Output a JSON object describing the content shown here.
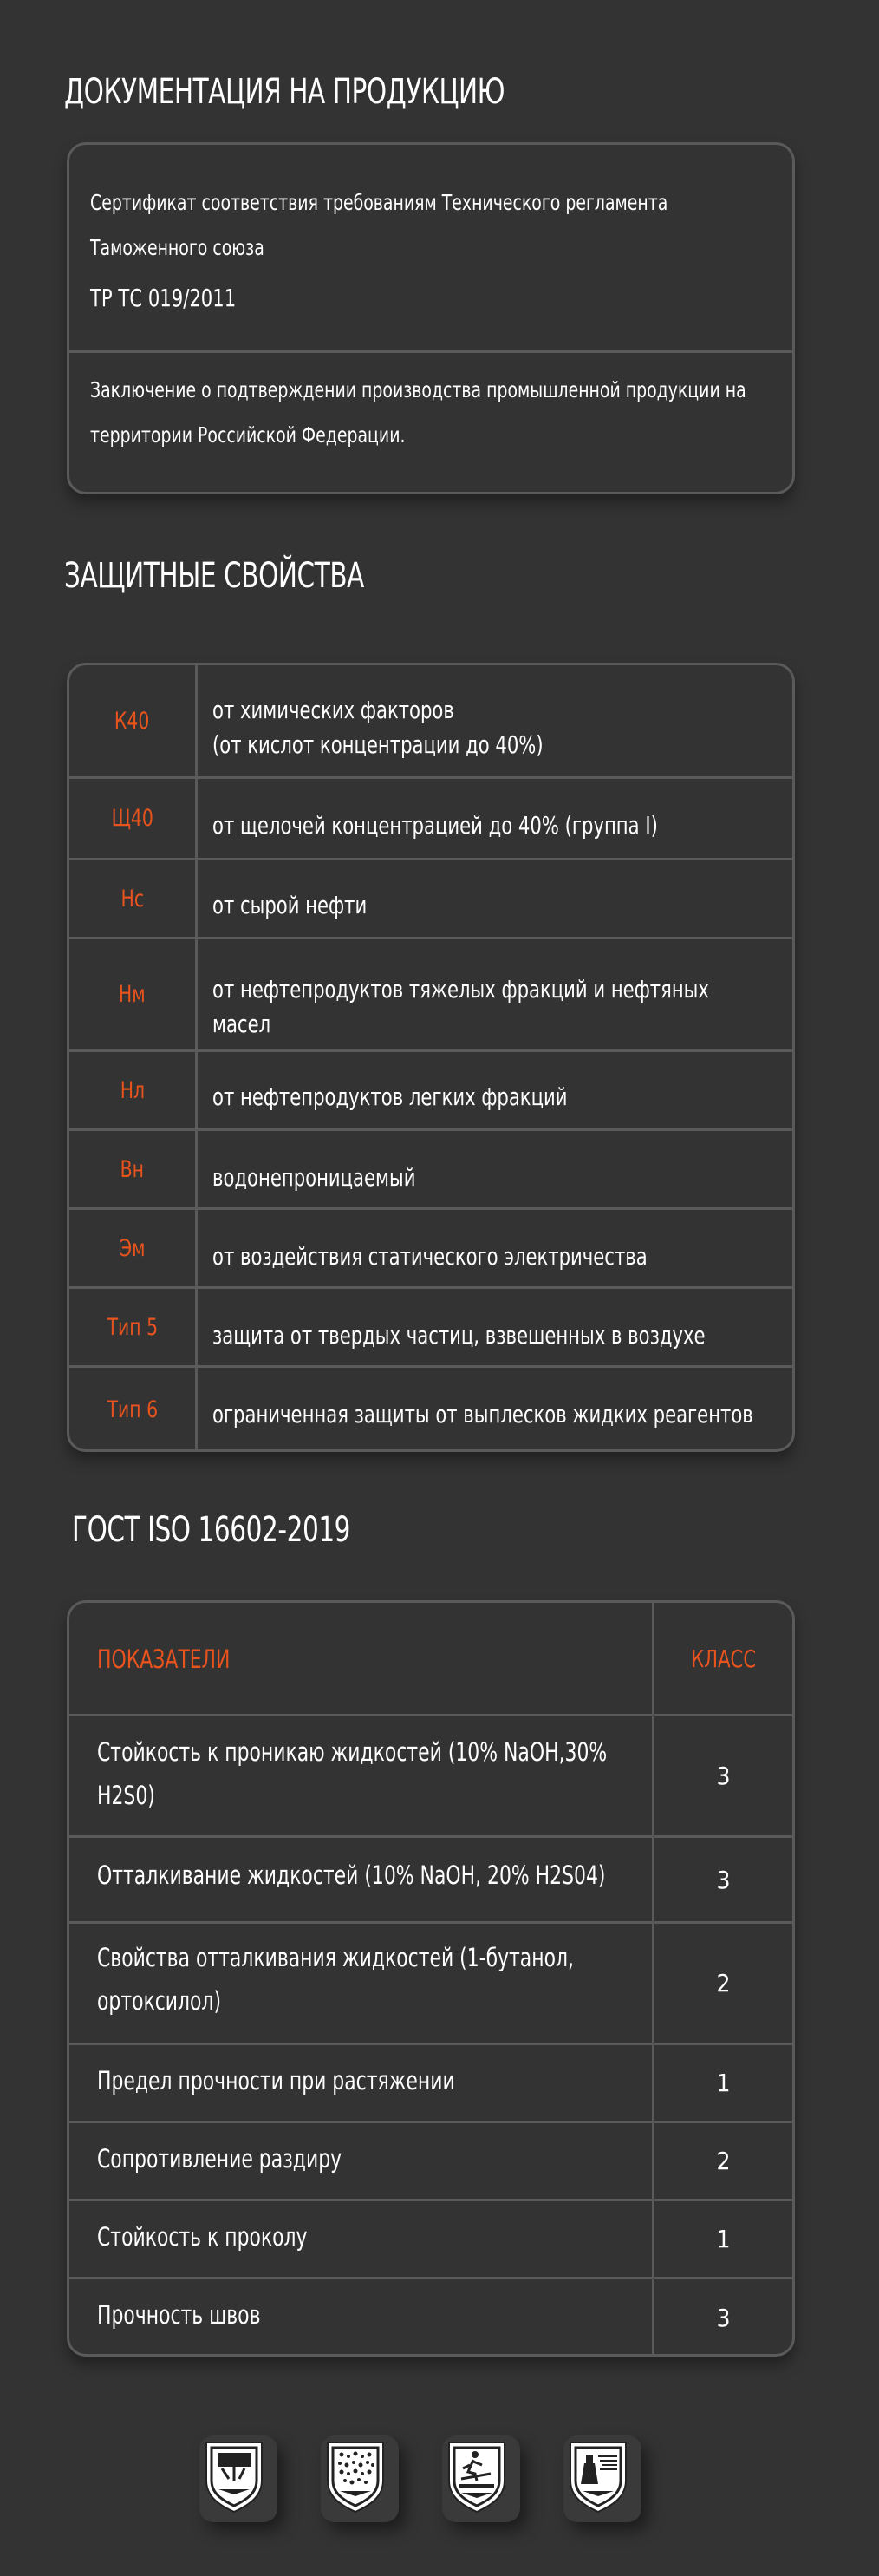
{
  "documentation": {
    "title": "ДОКУМЕНТАЦИЯ НА ПРОДУКЦИЮ",
    "certificate_line1": "Сертификат соответствия требованиям Технического регламента",
    "certificate_line2": "Таможенного союза",
    "certificate_code": "ТР ТС 019/2011",
    "conclusion_line1": " Заключение о подтверждении производства промышленной продукции на",
    "conclusion_line2": "территории Российской Федерации."
  },
  "protective": {
    "title": "ЗАЩИТНЫЕ СВОЙСТВА",
    "rows": [
      {
        "code": "К40",
        "line1": "от химических факторов",
        "line2": "(от кислот концентрации до 40%)"
      },
      {
        "code": "Щ40",
        "line1": "от щелочей концентрацией до 40% (группа I)",
        "line2": ""
      },
      {
        "code": "Нс",
        "line1": "от сырой нефти",
        "line2": ""
      },
      {
        "code": "Нм",
        "line1": "от нефтепродуктов тяжелых фракций и нефтяных",
        "line2": "масел"
      },
      {
        "code": "Нл",
        "line1": "от нефтепродуктов легких фракций",
        "line2": ""
      },
      {
        "code": "Вн",
        "line1": "водонепроницаемый",
        "line2": ""
      },
      {
        "code": "Эм",
        "line1": "от воздействия статического электричества",
        "line2": ""
      },
      {
        "code": "Тип 5",
        "line1": "защита от твердых частиц, взвешенных в воздухе",
        "line2": ""
      },
      {
        "code": "Тип 6",
        "line1": "ограниченная защиты от выплесков жидких реагентов",
        "line2": ""
      }
    ]
  },
  "gost": {
    "title": "ГОСТ ISO 16602-2019",
    "header_indicator": "ПОКАЗАТЕЛИ",
    "header_class": "КЛАСС",
    "rows": [
      {
        "line1": "Стойкость к проникаю жидкостей   (10% NaOH,30%",
        "line2": "H2S0)",
        "class": "3"
      },
      {
        "line1": "Отталкивание жидкостей  (10% NaOH, 20% H2S04)",
        "line2": "",
        "class": "3"
      },
      {
        "line1": "Свойства отталкивания жидкостей  (1-бутанол,",
        "line2": "ортоксилол)",
        "class": "2"
      },
      {
        "line1": "Предел прочности при растяжении",
        "line2": "",
        "class": "1"
      },
      {
        "line1": "Сопротивление раздиру",
        "line2": "",
        "class": "2"
      },
      {
        "line1": "Стойкость к проколу",
        "line2": "",
        "class": "1"
      },
      {
        "line1": "Прочность швов",
        "line2": "",
        "class": "3"
      }
    ]
  },
  "icons": [
    {
      "name": "liquid-splash-shield-icon"
    },
    {
      "name": "particles-shield-icon"
    },
    {
      "name": "chemical-hazard-shield-icon"
    },
    {
      "name": "spray-protection-shield-icon"
    }
  ],
  "colors": {
    "background": "#333333",
    "accent": "#e8531e",
    "border": "#5a5a5a"
  }
}
